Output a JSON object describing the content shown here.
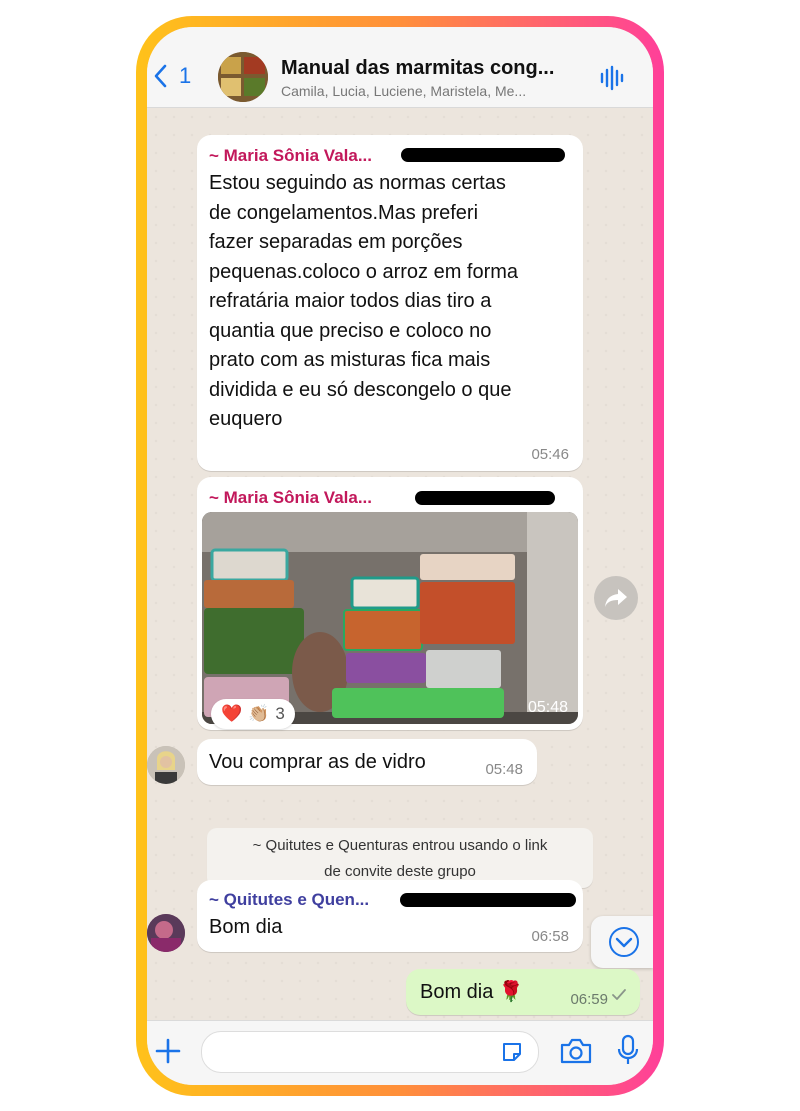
{
  "header": {
    "back_count": "1",
    "title": "Manual das marmitas cong...",
    "members": "Camila, Lucia, Luciene, Maristela, Me..."
  },
  "messages": [
    {
      "sender": "~ Maria Sônia Vala...",
      "sender_color": "#c2185b",
      "lines": [
        "Estou seguindo as normas certas",
        "de congelamentos.Mas preferi",
        "fazer separadas em porções",
        "pequenas.coloco o arroz em forma",
        "refratária maior todos dias tiro a",
        "quantia que preciso e coloco no",
        "prato com as misturas fica mais",
        "dividida e eu só descongelo o que",
        "euquero"
      ],
      "time": "05:46"
    },
    {
      "sender": "~ Maria Sônia Vala...",
      "sender_color": "#c2185b",
      "image": "photo of frozen meal containers in a freezer",
      "time": "05:48",
      "reactions": {
        "emojis": [
          "❤️",
          "👏🏼"
        ],
        "count": "3"
      }
    },
    {
      "text": "Vou comprar as de vidro",
      "time": "05:48"
    },
    {
      "system": [
        "~ Quitutes e Quenturas entrou usando o link",
        "de convite deste grupo"
      ]
    },
    {
      "sender": "~ Quitutes e Quen...",
      "sender_color": "#3f3f9f",
      "text": "Bom dia",
      "time": "06:58"
    },
    {
      "outgoing": true,
      "text": "Bom dia 🌹",
      "time": "06:59"
    }
  ],
  "icons": {
    "back": "chevron-left-icon",
    "audio": "waveform-icon",
    "forward": "forward-share-icon",
    "scroll_down": "chevron-down-circle-icon",
    "add": "plus-icon",
    "sticker": "sticker-icon",
    "camera": "camera-icon",
    "mic": "microphone-icon"
  },
  "colors": {
    "accent": "#1a73e8",
    "outgoing_bubble": "#dcf8c6",
    "chat_background": "#ece5dd"
  }
}
